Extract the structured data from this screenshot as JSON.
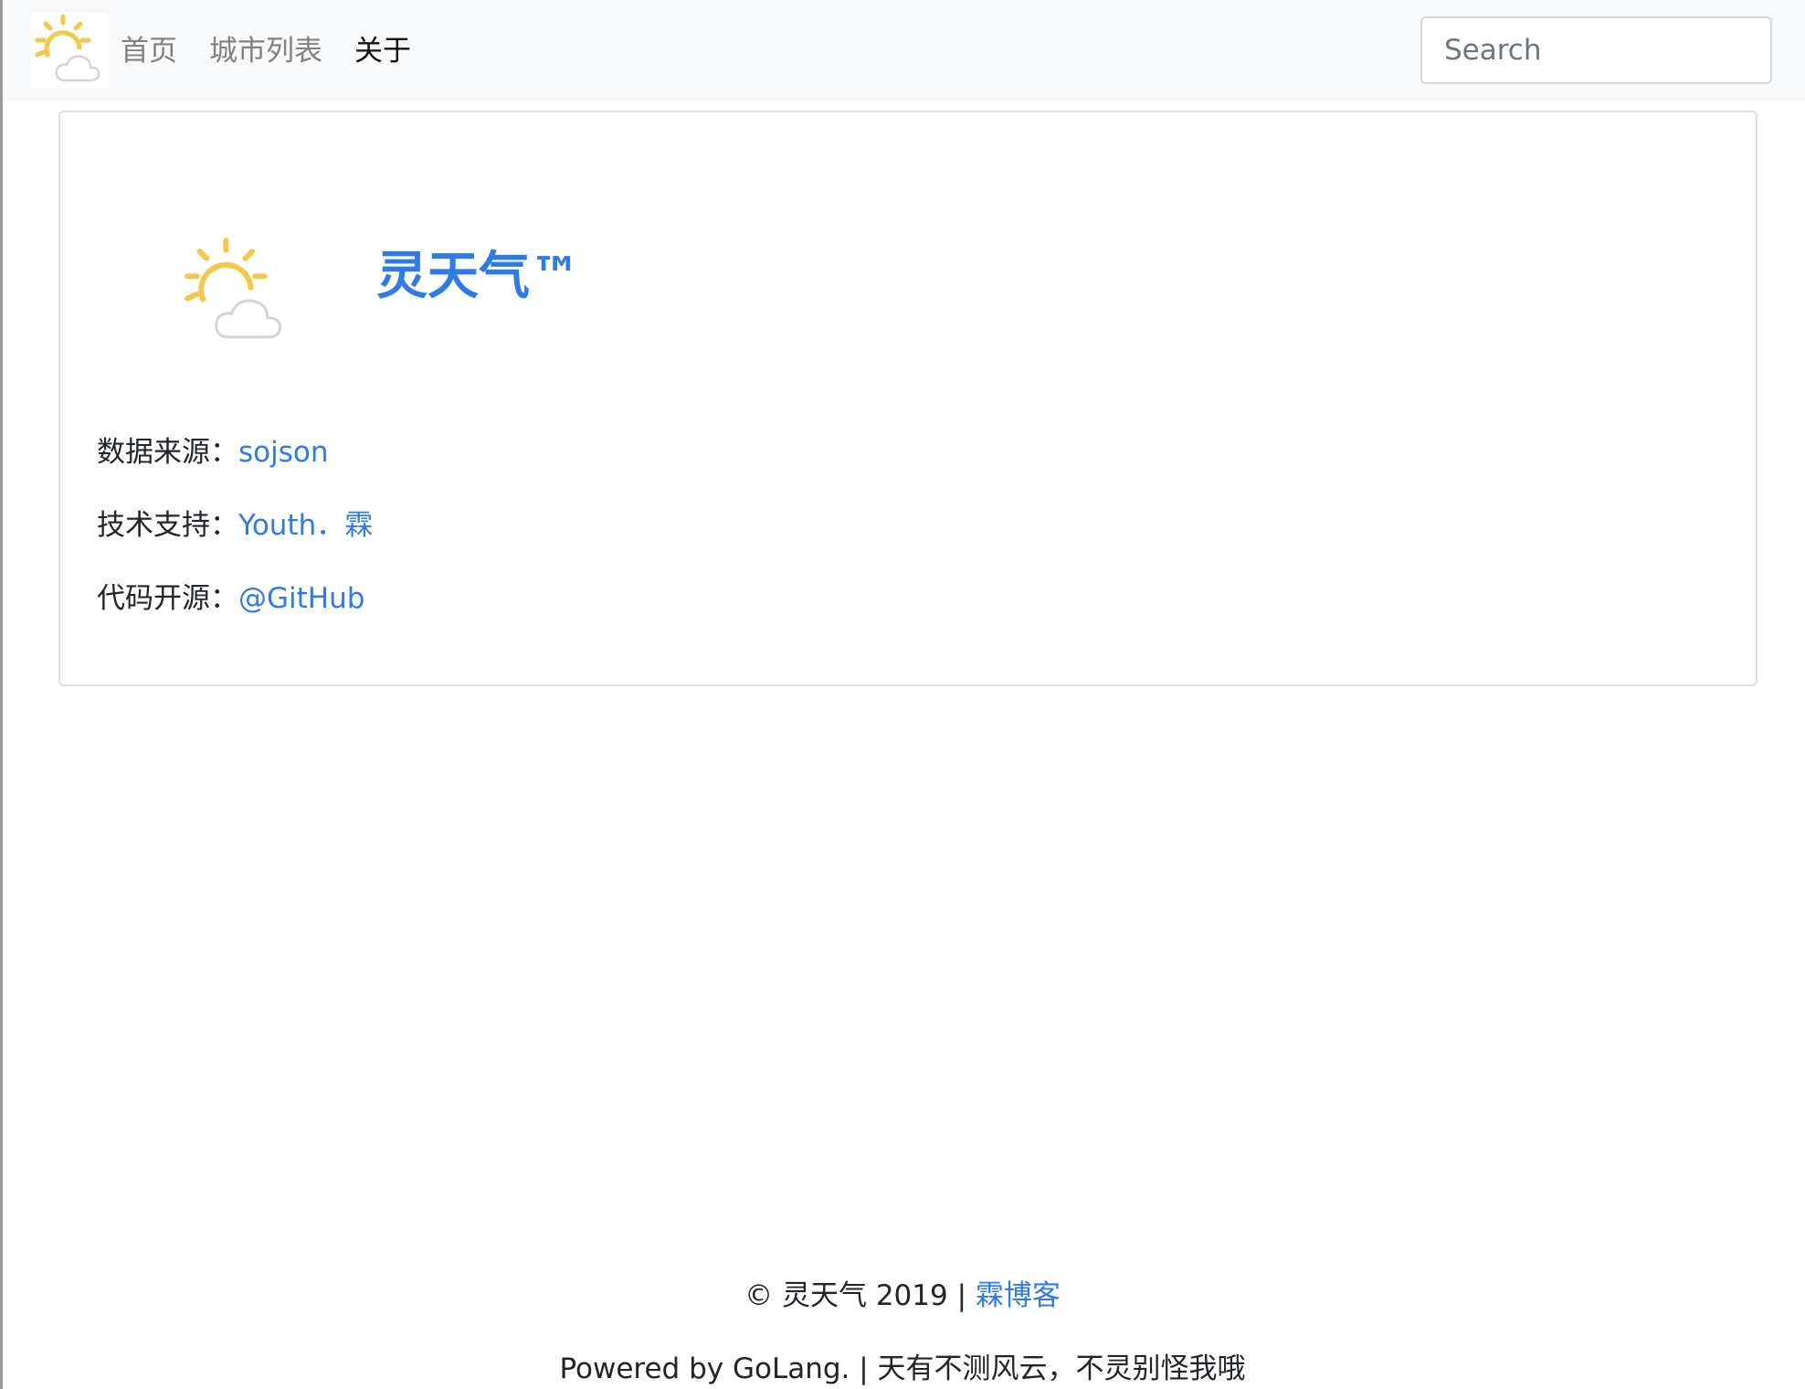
{
  "navbar": {
    "brand_icon": "partly-cloudy-icon",
    "links": [
      {
        "label": "首页",
        "active": false
      },
      {
        "label": "城市列表",
        "active": false
      },
      {
        "label": "关于",
        "active": true
      }
    ],
    "search": {
      "placeholder": "Search",
      "value": ""
    }
  },
  "about": {
    "logo_icon": "partly-cloudy-icon",
    "title": "灵天气™",
    "rows": [
      {
        "label": "数据来源：",
        "link_text": "sojson"
      },
      {
        "label": "技术支持：",
        "link_text": "Youth．霖"
      },
      {
        "label": "代码开源：",
        "link_text": "@GitHub"
      }
    ]
  },
  "footer": {
    "copyright_prefix": "© 灵天气 2019 | ",
    "blog_link": "霖博客",
    "powered": "Powered by GoLang. | 天有不测风云，不灵别怪我哦"
  },
  "colors": {
    "link": "#2f7be5",
    "navbar_bg": "#f8f9fa",
    "sun": "#f2c94c"
  }
}
